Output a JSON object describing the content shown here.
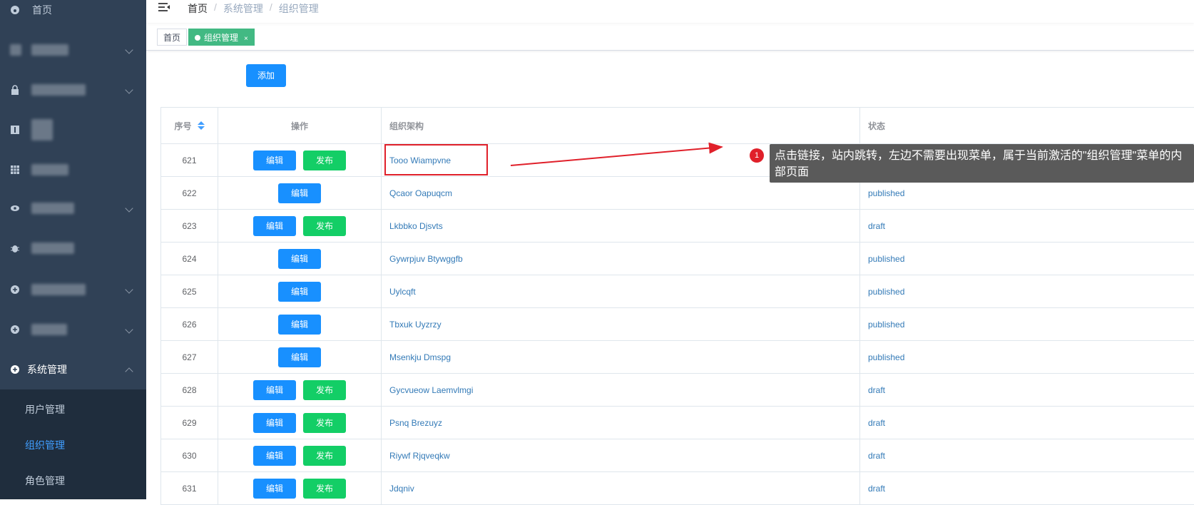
{
  "sidebar": {
    "home_label": "首页",
    "system_label": "系统管理",
    "submenu": [
      "用户管理",
      "组织管理",
      "角色管理"
    ],
    "active_sub": "组织管理",
    "colors": {
      "bg": "#304156",
      "submenu_bg": "#1f2d3d",
      "active": "#409eff"
    }
  },
  "navbar": {
    "breadcrumb": [
      "首页",
      "系统管理",
      "组织管理"
    ],
    "separator": "/"
  },
  "tags": [
    {
      "label": "首页",
      "active": false
    },
    {
      "label": "组织管理",
      "active": true,
      "close": "×"
    }
  ],
  "toolbar": {
    "add_label": "添加"
  },
  "table": {
    "columns": [
      "序号",
      "操作",
      "组织架构",
      "状态"
    ],
    "edit_label": "编辑",
    "publish_label": "发布",
    "rows": [
      {
        "id": "621",
        "name": "Tooo Wiampvne",
        "status": "",
        "publish": true
      },
      {
        "id": "622",
        "name": "Qcaor Oapuqcm",
        "status": "published",
        "publish": false
      },
      {
        "id": "623",
        "name": "Lkbbko Djsvts",
        "status": "draft",
        "publish": true
      },
      {
        "id": "624",
        "name": "Gywrpjuv Btywggfb",
        "status": "published",
        "publish": false
      },
      {
        "id": "625",
        "name": "Uylcqft",
        "status": "published",
        "publish": false
      },
      {
        "id": "626",
        "name": "Tbxuk Uyzrzy",
        "status": "published",
        "publish": false
      },
      {
        "id": "627",
        "name": "Msenkju Dmspg",
        "status": "published",
        "publish": false
      },
      {
        "id": "628",
        "name": "Gycvueow Laemvlmgi",
        "status": "draft",
        "publish": true
      },
      {
        "id": "629",
        "name": "Psnq Brezuyz",
        "status": "draft",
        "publish": true
      },
      {
        "id": "630",
        "name": "Riywf Rjqveqkw",
        "status": "draft",
        "publish": true
      },
      {
        "id": "631",
        "name": "Jdqniv",
        "status": "draft",
        "publish": true
      }
    ]
  },
  "annotation": {
    "number": "1",
    "text": "点击链接，站内跳转，左边不需要出现菜单，属于当前激活的\"组织管理\"菜单的内部页面",
    "color": "#e0202a"
  }
}
